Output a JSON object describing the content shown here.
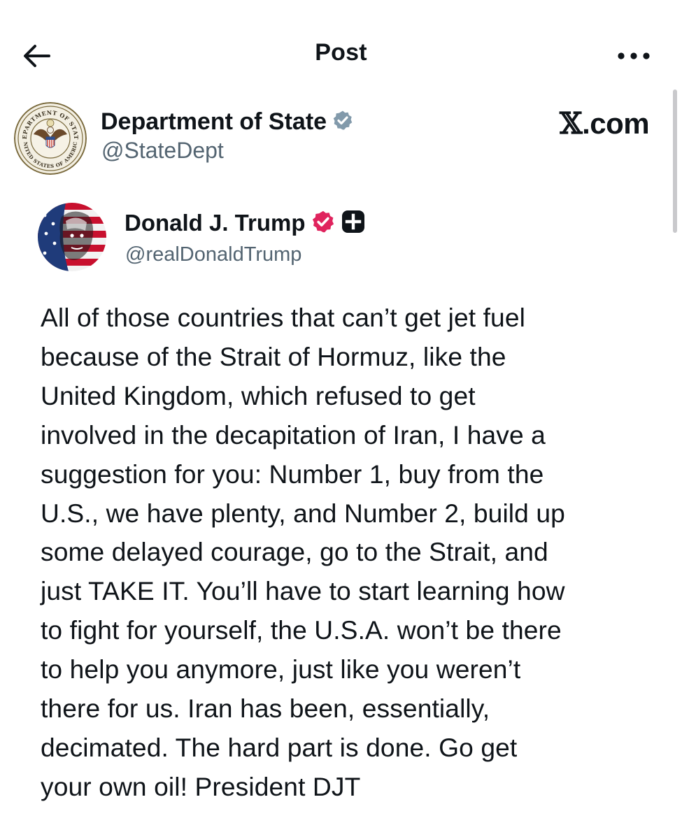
{
  "header": {
    "title": "Post",
    "back_icon": "arrow-left-icon",
    "more_icon": "more-horizontal-icon"
  },
  "account": {
    "name": "Department of State",
    "handle": "@StateDept",
    "verified": true,
    "badge_color": "#829aab",
    "seal_lettering": [
      "DEPARTMENT OF STATE",
      "UNITED STATES OF AMERICA"
    ]
  },
  "watermark": {
    "text": ".com",
    "glyph": "𝕏"
  },
  "post": {
    "author_name": "Donald J. Trump",
    "author_handle": "@realDonaldTrump",
    "verified_badge_color": "#e0245e",
    "extra_badge_icon": "plus-square-icon",
    "body_lines": [
      "All of those countries that can’t get jet fuel",
      "because of the Strait of Hormuz, like the",
      "United Kingdom, which refused to get",
      "involved in the decapitation of Iran, I have a",
      "suggestion for you: Number 1, buy from the",
      "U.S., we have plenty, and Number 2, build up",
      "some delayed courage, go to the Strait, and",
      "just TAKE IT. You’ll have to start learning how",
      "to fight for yourself, the U.S.A. won’t be there",
      "to help you anymore, just like you weren’t",
      "there for us. Iran has been, essentially,",
      "decimated. The hard part is done. Go get",
      "your own oil! President DJT"
    ]
  }
}
